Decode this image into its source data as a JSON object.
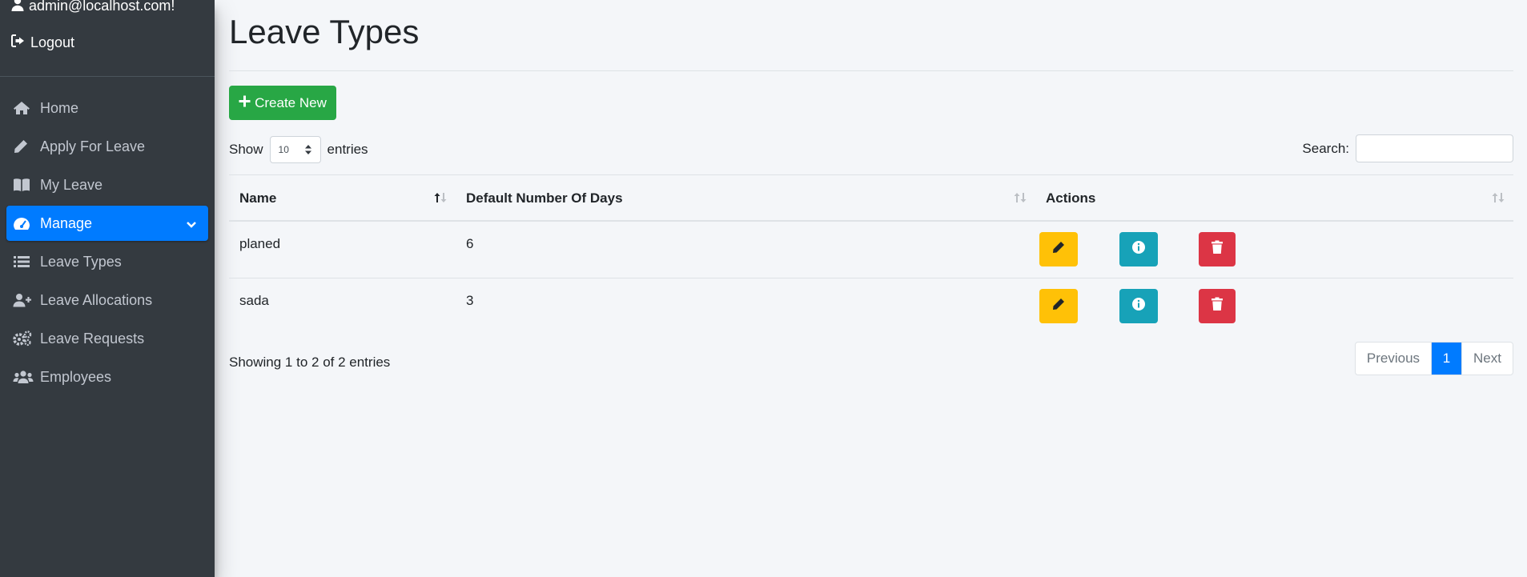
{
  "sidebar": {
    "user_email": "admin@localhost.com!",
    "logout_label": "Logout",
    "items": [
      {
        "label": "Home",
        "icon": "home-icon"
      },
      {
        "label": "Apply For Leave",
        "icon": "pencil-icon"
      },
      {
        "label": "My Leave",
        "icon": "book-icon"
      },
      {
        "label": "Manage",
        "icon": "tachometer-icon",
        "active": true
      },
      {
        "label": "Leave Types",
        "icon": "list-icon"
      },
      {
        "label": "Leave Allocations",
        "icon": "user-plus-icon"
      },
      {
        "label": "Leave Requests",
        "icon": "gears-icon"
      },
      {
        "label": "Employees",
        "icon": "users-icon"
      }
    ]
  },
  "page": {
    "title": "Leave Types",
    "create_label": "Create New"
  },
  "table_controls": {
    "show_label": "Show",
    "entries_label": "entries",
    "page_length": "10",
    "search_label": "Search:",
    "search_value": ""
  },
  "table": {
    "columns": [
      "Name",
      "Default Number Of Days",
      "Actions"
    ],
    "rows": [
      {
        "name": "planed",
        "days": "6"
      },
      {
        "name": "sada",
        "days": "3"
      }
    ]
  },
  "footer": {
    "info": "Showing 1 to 2 of 2 entries",
    "prev_label": "Previous",
    "current_page": "1",
    "next_label": "Next"
  },
  "colors": {
    "sidebar_bg": "#343a40",
    "active_nav": "#007bff",
    "create_button": "#28a745",
    "edit_button": "#ffc107",
    "info_button": "#17a2b8",
    "delete_button": "#dc3545"
  }
}
